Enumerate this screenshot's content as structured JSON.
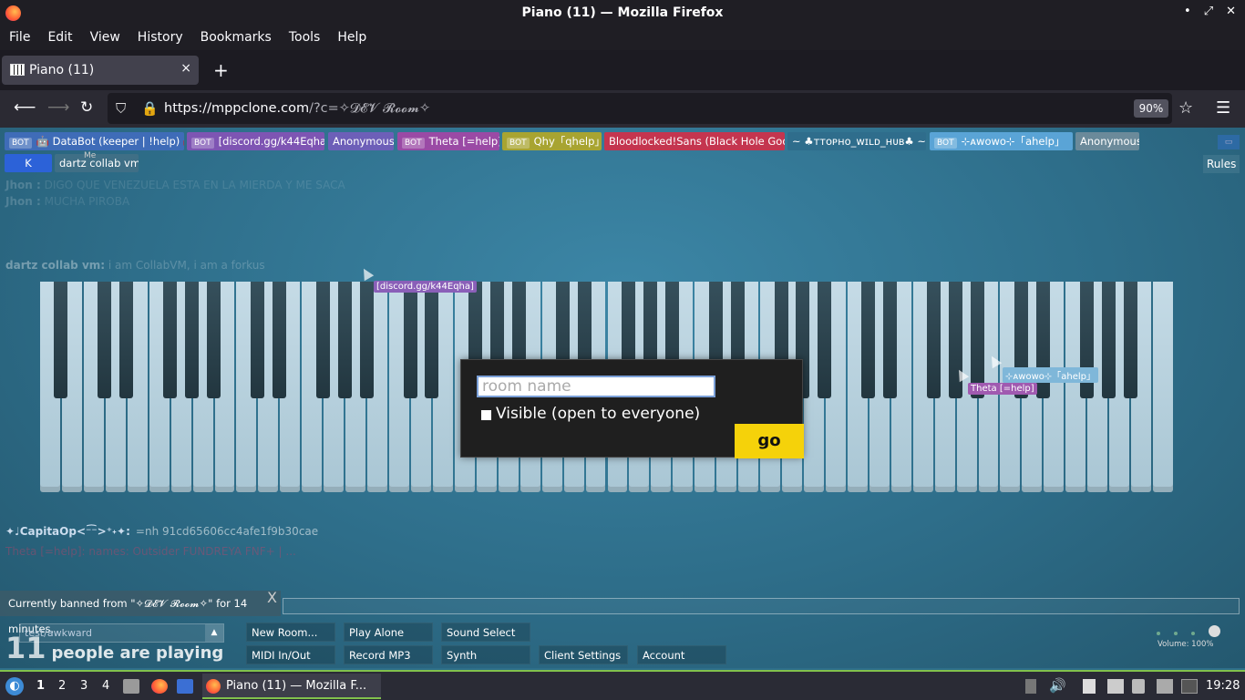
{
  "window": {
    "title": "Piano (11) — Mozilla Firefox",
    "controls": [
      "•",
      "⤢",
      "✕"
    ]
  },
  "menubar": [
    "File",
    "Edit",
    "View",
    "History",
    "Bookmarks",
    "Tools",
    "Help"
  ],
  "tab": {
    "title": "Piano (11)",
    "close": "×",
    "new_tab": "+"
  },
  "nav": {
    "url_main": "https://mppclone.com",
    "url_rest": "/?c=✧𝓓𝓔𝓥 𝓡𝓸𝓸𝓶✧",
    "zoom": "90%"
  },
  "players": [
    {
      "bot": true,
      "name": "🤖 DataBot (keeper | !help) 🤖",
      "color": "#3f6cb8"
    },
    {
      "bot": true,
      "name": "[discord.gg/k44Eqha]",
      "color": "#7e55b3"
    },
    {
      "bot": false,
      "name": "Anonymous",
      "color": "#6d5fb8"
    },
    {
      "bot": true,
      "name": "Theta [=help]",
      "color": "#9a4aa5"
    },
    {
      "bot": true,
      "name": "Qhy「qhelp」",
      "color": "#a8a431"
    },
    {
      "bot": false,
      "name": "Bloodlocked!Sans (Black Hole God)",
      "color": "#c4354f"
    },
    {
      "bot": false,
      "name": "~ ♣ᴛᴛᴏᴘʜᴏ_ᴡɪʟᴅ_ʜᴜʙ♣ ~",
      "color": "#2f6d8c"
    },
    {
      "bot": true,
      "name": "⊹ᴀᴡᴏᴡᴏ⊹「ahelp」",
      "color": "#5aa4d6"
    },
    {
      "bot": false,
      "name": "Anonymous",
      "color": "#6b8a9a"
    },
    {
      "bot": false,
      "name": "K",
      "color": "#2c62d8"
    },
    {
      "bot": false,
      "name": "dartz collab vm",
      "color": "#3f6f86"
    }
  ],
  "me_label": "Me",
  "rules": "Rules",
  "chat": [
    {
      "user": "Jhon :",
      "msg": "DIGO QUE VENEZUELA ESTA EN LA MIERDA Y ME SACA"
    },
    {
      "user": "Jhon :",
      "msg": "MUCHA PIROBA"
    },
    {
      "user": "",
      "msg": ""
    },
    {
      "user": "",
      "msg": ""
    },
    {
      "user": "",
      "msg": ""
    },
    {
      "user": "dartz collab vm:",
      "msg": "i am CollabVM, i am a forkus"
    }
  ],
  "hash_line": {
    "user": "✦♩CapitaOp<⁻͡⁻>⁺˖✦:",
    "msg": "=nh 91cd65606cc4afe1f9b30cae"
  },
  "theta_line": "Theta [=help]: names: Outsider FUNDREYA FNF+ | ...",
  "cursor_tags": [
    {
      "text": "[discord.gg/k44Eqha]",
      "color": "#8a5fb8"
    },
    {
      "text": "⊹ᴀᴡᴏᴡᴏ⊹「ahelp」",
      "color": "#7fb7d9"
    },
    {
      "text": "Theta [=help]",
      "color": "#a05ab0"
    }
  ],
  "modal": {
    "placeholder": "room name",
    "visible_label": "Visible (open to everyone)",
    "go": "go"
  },
  "ban_notice": "Currently banned from \"✧𝓓𝓔𝓥 𝓡𝓸𝓸𝓶✧\" for 14 minutes.",
  "ban_close": "X",
  "bottom": {
    "room_select": "test/awkward",
    "people_count": "11",
    "people_text": "people are playing",
    "buttons_row1": [
      "New Room...",
      "Play Alone",
      "Sound Select"
    ],
    "buttons_row2": [
      "MIDI In/Out",
      "Record MP3",
      "Synth",
      "Client Settings",
      "Account"
    ],
    "volume": "Volume: 100%"
  },
  "taskbar": {
    "workspaces": [
      "1",
      "2",
      "3",
      "4"
    ],
    "task": "Piano (11) — Mozilla F...",
    "clock": "19:28"
  }
}
